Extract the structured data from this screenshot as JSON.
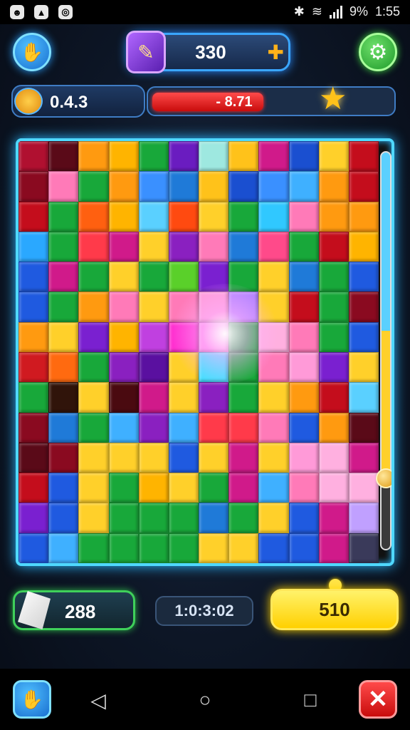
{
  "status_bar": {
    "battery": "9%",
    "time": "1:55"
  },
  "header": {
    "score": "330",
    "level": "0.4.3",
    "progress_text": "- 8.71",
    "progress_fraction": 0.68
  },
  "board": {
    "slider_fraction": 0.82,
    "pieces": [
      "#b01030",
      "#5a0a18",
      "#ff9a10",
      "#ffb400",
      "#18a83a",
      "#6a1cc0",
      "#9ee8e0",
      "#ffc21a",
      "#d01a8a",
      "#1a4fd0",
      "#ffd02a",
      "#c40d1c",
      "#8a0a20",
      "#ff7ab8",
      "#18a83a",
      "#ff9a10",
      "#3a90ff",
      "#1f7ad8",
      "#ffc21a",
      "#1a4fd0",
      "#3a90ff",
      "#3fb0ff",
      "#ff9a10",
      "#c40d1c",
      "#c40d1c",
      "#18a83a",
      "#ff6010",
      "#ffb400",
      "#5ad0ff",
      "#ff4a10",
      "#ffd02a",
      "#18a83a",
      "#30c8ff",
      "#ff7ab8",
      "#ff9a10",
      "#ff9a10",
      "#2aa8ff",
      "#18a83a",
      "#ff3a4a",
      "#d01a8a",
      "#ffd02a",
      "#8a20c0",
      "#ff7ab8",
      "#1f7ad8",
      "#ff4a8a",
      "#18a83a",
      "#c40d1c",
      "#ffb400",
      "#1f5ae0",
      "#d01a8a",
      "#18a83a",
      "#ffd02a",
      "#18a83a",
      "#5ad02a",
      "#7a20d0",
      "#18a83a",
      "#ffd02a",
      "#1f7ad8",
      "#18a83a",
      "#1f5ae0",
      "#1f5ae0",
      "#18a83a",
      "#ff9a10",
      "#ff7ab8",
      "#ffd02a",
      "#ff7ab8",
      "#ff9ad8",
      "#b080ff",
      "#ffd02a",
      "#c40d1c",
      "#18a83a",
      "#8a0a20",
      "#ff9a10",
      "#ffd02a",
      "#7a20d0",
      "#ffb400",
      "#c040e0",
      "#ff30d0",
      "#ff8ae8",
      "#18a83a",
      "#ffb0e0",
      "#ff7ab8",
      "#18a83a",
      "#1f5ae0",
      "#d01a20",
      "#ff6a10",
      "#18a83a",
      "#8a20c0",
      "#5a10a0",
      "#ffd02a",
      "#40e0ff",
      "#18a83a",
      "#ff7ab8",
      "#ff9ad8",
      "#7a20d0",
      "#ffd02a",
      "#18a83a",
      "#30140a",
      "#ffd02a",
      "#4a0a10",
      "#d01a8a",
      "#ffd02a",
      "#8a20c0",
      "#18a83a",
      "#ffd02a",
      "#ff9a10",
      "#c40d1c",
      "#5ad0ff",
      "#8a0a20",
      "#1f7ad8",
      "#18a83a",
      "#3fb0ff",
      "#8a20c0",
      "#3fb0ff",
      "#ff3a4a",
      "#ff3a4a",
      "#ff7ab8",
      "#1f5ae0",
      "#ff9a10",
      "#5a0a18",
      "#5a0a18",
      "#8a0a20",
      "#ffd02a",
      "#ffd02a",
      "#ffd02a",
      "#1f5ae0",
      "#ffd02a",
      "#d01a8a",
      "#ffd02a",
      "#ff9ad8",
      "#ffb0e0",
      "#d01a8a",
      "#c40d1c",
      "#1f5ae0",
      "#ffd02a",
      "#18a83a",
      "#ffb400",
      "#ffd02a",
      "#18a83a",
      "#d01a8a",
      "#3fb0ff",
      "#ff7ab8",
      "#ffb0e0",
      "#ffb0e0",
      "#7a20d0",
      "#1f5ae0",
      "#ffd02a",
      "#18a83a",
      "#18a83a",
      "#18a83a",
      "#1f7ad8",
      "#18a83a",
      "#ffd02a",
      "#1f5ae0",
      "#d01a8a",
      "#c0a0ff",
      "#1f5ae0",
      "#3fb0ff",
      "#18a83a",
      "#18a83a",
      "#18a83a",
      "#18a83a",
      "#ffd02a",
      "#ffd02a",
      "#1f5ae0",
      "#1f5ae0",
      "#d01a8a",
      "#3a3a5a"
    ]
  },
  "footer": {
    "gems": "288",
    "timer": "1:0:3:02",
    "gold_value": "510"
  },
  "colors": {
    "accent": "#4fd8ff",
    "progress": "#e81a1a",
    "gold": "#ffd400",
    "gems_border": "#3fd05a"
  },
  "icons": {
    "hand": "hand-icon",
    "settings": "gear-icon",
    "score_badge": "feather-icon",
    "puzzle": "puzzle-piece-icon",
    "star": "star-icon",
    "gem": "gem-icon",
    "close": "close-icon"
  }
}
